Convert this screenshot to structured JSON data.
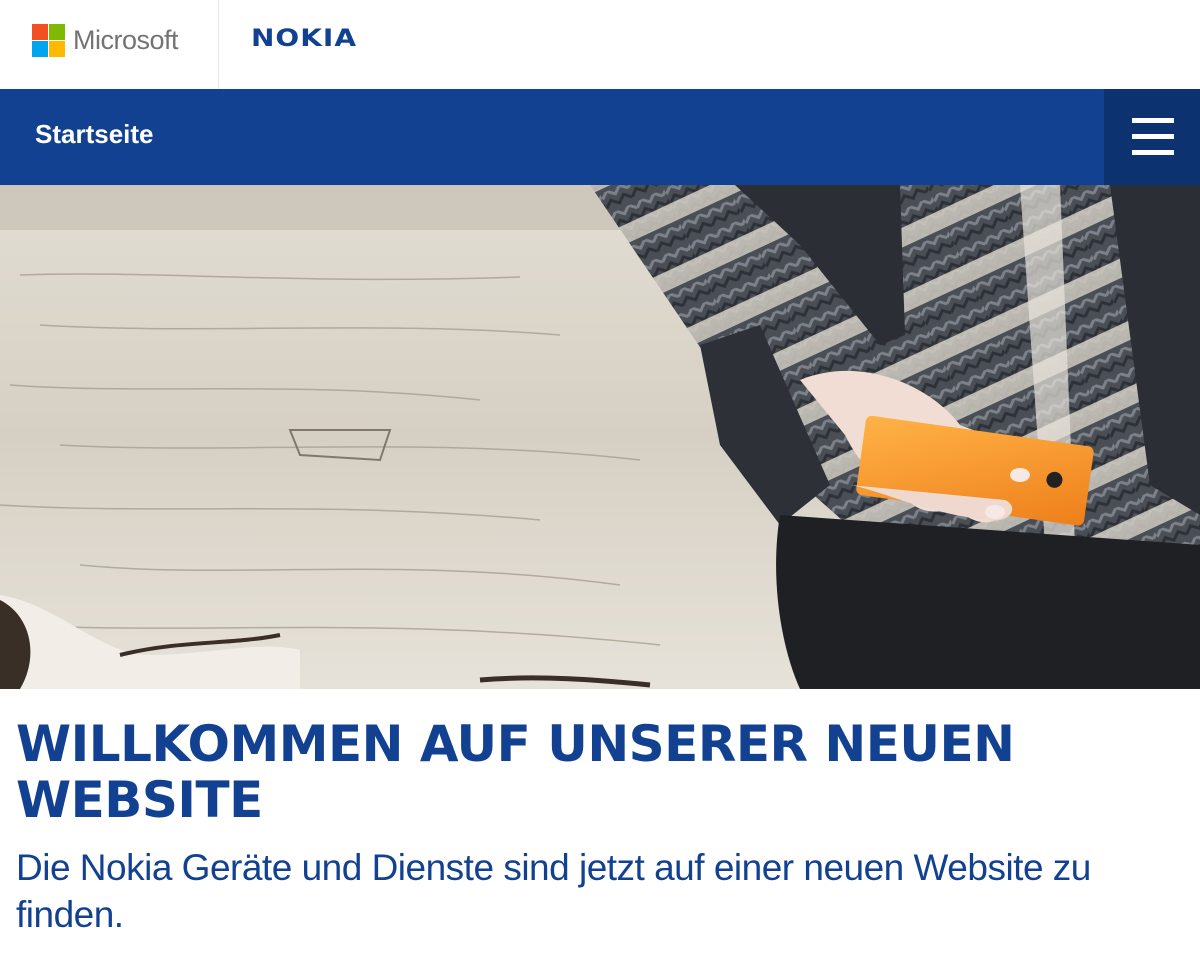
{
  "header": {
    "microsoft_label": "Microsoft",
    "nokia_label": "NOKIA",
    "ms_colors": [
      "#f25022",
      "#7fba00",
      "#00a4ef",
      "#ffb900"
    ]
  },
  "nav": {
    "title": "Startseite",
    "menu_icon": "hamburger-menu-icon"
  },
  "hero": {
    "image": "person-holding-orange-phone-photo"
  },
  "main": {
    "headline": "Willkommen auf unserer neuen Website",
    "subline": "Die Nokia Geräte und Dienste sind jetzt auf einer neuen Website zu finden."
  },
  "colors": {
    "brand_blue": "#124191",
    "menu_dark_blue": "#0c3270",
    "phone_orange": "#f0902b"
  }
}
